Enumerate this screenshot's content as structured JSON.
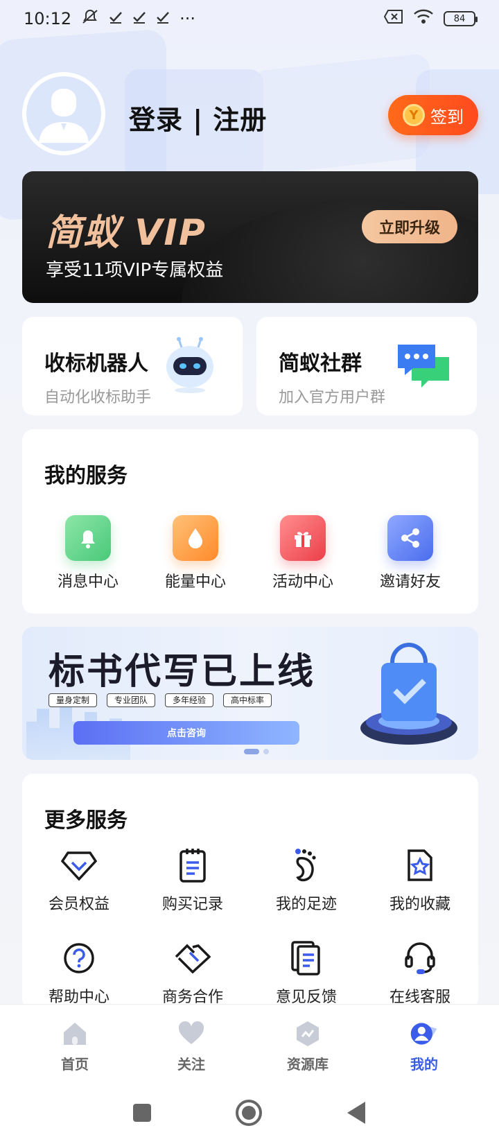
{
  "status_bar": {
    "time": "10:12",
    "battery": "84",
    "dots": "···"
  },
  "header": {
    "auth_text": "登录 | 注册",
    "signin_label": "签到",
    "signin_coin": "Y"
  },
  "vip": {
    "title": "简蚁 VIP",
    "subtitle": "享受11项VIP专属权益",
    "upgrade_label": "立即升级"
  },
  "features": [
    {
      "title": "收标机器人",
      "subtitle": "自动化收标助手",
      "icon": "robot-icon"
    },
    {
      "title": "简蚁社群",
      "subtitle": "加入官方用户群",
      "icon": "chat-bubble-icon"
    }
  ],
  "my_services": {
    "title": "我的服务",
    "items": [
      {
        "label": "消息中心",
        "icon": "bell-icon",
        "color": "#5fd38a"
      },
      {
        "label": "能量中心",
        "icon": "drop-icon",
        "color": "#ff9a3c"
      },
      {
        "label": "活动中心",
        "icon": "gift-icon",
        "color": "#f2585c"
      },
      {
        "label": "邀请好友",
        "icon": "share-icon",
        "color": "#5a7ef0"
      }
    ]
  },
  "promo": {
    "title": "标书代写已上线",
    "tags": [
      "量身定制",
      "专业团队",
      "多年经验",
      "高中标率"
    ],
    "button": "点击咨询"
  },
  "more_services": {
    "title": "更多服务",
    "items": [
      {
        "label": "会员权益",
        "icon": "diamond-icon"
      },
      {
        "label": "购买记录",
        "icon": "clipboard-icon"
      },
      {
        "label": "我的足迹",
        "icon": "footprint-icon"
      },
      {
        "label": "我的收藏",
        "icon": "star-bookmark-icon"
      },
      {
        "label": "帮助中心",
        "icon": "help-icon"
      },
      {
        "label": "商务合作",
        "icon": "handshake-icon"
      },
      {
        "label": "意见反馈",
        "icon": "feedback-icon"
      },
      {
        "label": "在线客服",
        "icon": "headset-icon"
      }
    ]
  },
  "tabbar": {
    "items": [
      {
        "label": "首页",
        "icon": "home-icon"
      },
      {
        "label": "关注",
        "icon": "heart-icon"
      },
      {
        "label": "资源库",
        "icon": "library-icon"
      },
      {
        "label": "我的",
        "icon": "profile-icon",
        "active": true
      }
    ]
  },
  "colors": {
    "accent": "#3a5ce8",
    "signin": "#ff5a1f",
    "vip_gold": "#f1c09c"
  }
}
